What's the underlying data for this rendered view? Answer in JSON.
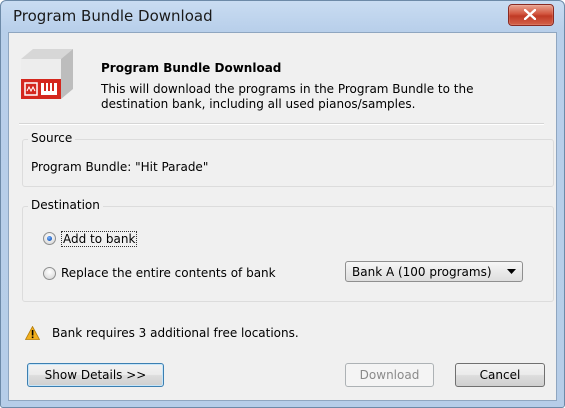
{
  "window": {
    "title": "Program Bundle Download"
  },
  "header": {
    "title": "Program Bundle Download",
    "description": "This will download the programs in the Program Bundle to the destination bank, including all used pianos/samples.",
    "icon": "program-bundle-icon"
  },
  "source": {
    "group_label": "Source",
    "text": "Program Bundle: \"Hit Parade\""
  },
  "destination": {
    "group_label": "Destination",
    "options": [
      {
        "label": "Add to bank",
        "selected": true
      },
      {
        "label": "Replace the entire contents of bank",
        "selected": false
      }
    ],
    "bank_select": {
      "value": "Bank A (100 programs)"
    }
  },
  "warning": {
    "icon": "warning-icon",
    "text": "Bank requires 3 additional free locations."
  },
  "buttons": {
    "details": "Show Details >>",
    "download": "Download",
    "cancel": "Cancel"
  }
}
